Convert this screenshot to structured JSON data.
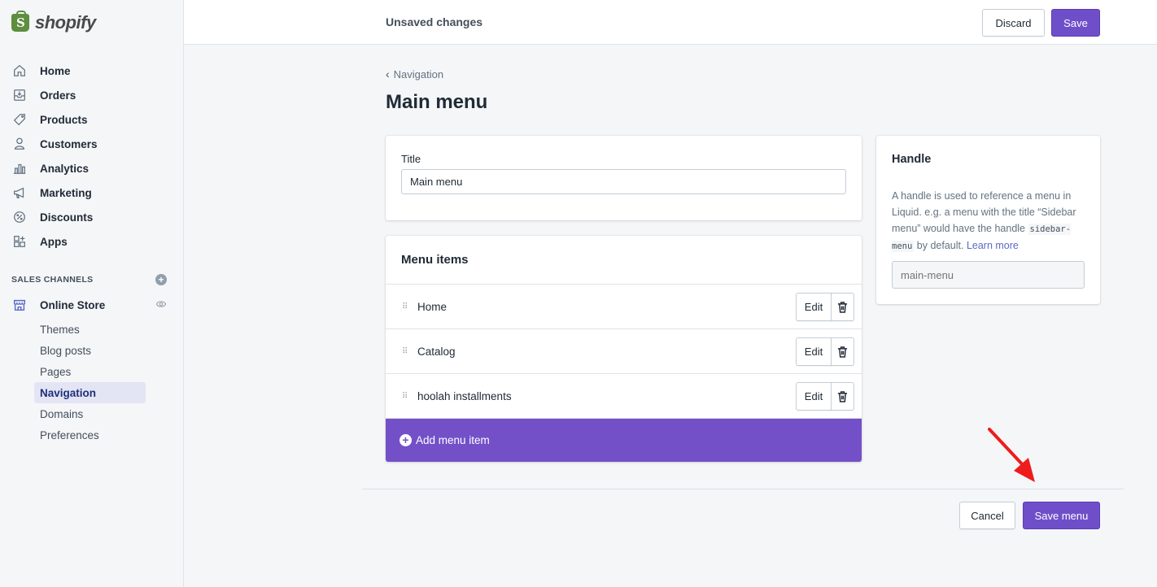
{
  "brand": {
    "name": "shopify"
  },
  "sidebar": {
    "items": [
      {
        "label": "Home",
        "icon": "home-icon"
      },
      {
        "label": "Orders",
        "icon": "orders-icon"
      },
      {
        "label": "Products",
        "icon": "tag-icon"
      },
      {
        "label": "Customers",
        "icon": "person-icon"
      },
      {
        "label": "Analytics",
        "icon": "bar-chart-icon"
      },
      {
        "label": "Marketing",
        "icon": "megaphone-icon"
      },
      {
        "label": "Discounts",
        "icon": "discount-icon"
      },
      {
        "label": "Apps",
        "icon": "apps-icon"
      }
    ],
    "sales_channels_label": "SALES CHANNELS",
    "online_store": "Online Store",
    "sub_items": [
      {
        "label": "Themes"
      },
      {
        "label": "Blog posts"
      },
      {
        "label": "Pages"
      },
      {
        "label": "Navigation",
        "active": true
      },
      {
        "label": "Domains"
      },
      {
        "label": "Preferences"
      }
    ]
  },
  "topbar": {
    "status": "Unsaved changes",
    "discard": "Discard",
    "save": "Save"
  },
  "page": {
    "breadcrumb": "Navigation",
    "title": "Main menu"
  },
  "title_card": {
    "label": "Title",
    "value": "Main menu"
  },
  "menu_card": {
    "heading": "Menu items",
    "items": [
      {
        "name": "Home",
        "edit": "Edit"
      },
      {
        "name": "Catalog",
        "edit": "Edit"
      },
      {
        "name": "hoolah installments",
        "edit": "Edit"
      }
    ],
    "add_label": "Add menu item"
  },
  "handle_card": {
    "title": "Handle",
    "desc_1": "A handle is used to reference a menu in Liquid. e.g. a menu with the title “Sidebar menu” would have the handle",
    "code": "sidebar-menu",
    "desc_2": "by default.",
    "link": "Learn more",
    "placeholder": "main-menu"
  },
  "footer": {
    "cancel": "Cancel",
    "save_menu": "Save menu"
  },
  "colors": {
    "primary": "#6f4fc9",
    "annotation_arrow": "#ee1c1c"
  }
}
